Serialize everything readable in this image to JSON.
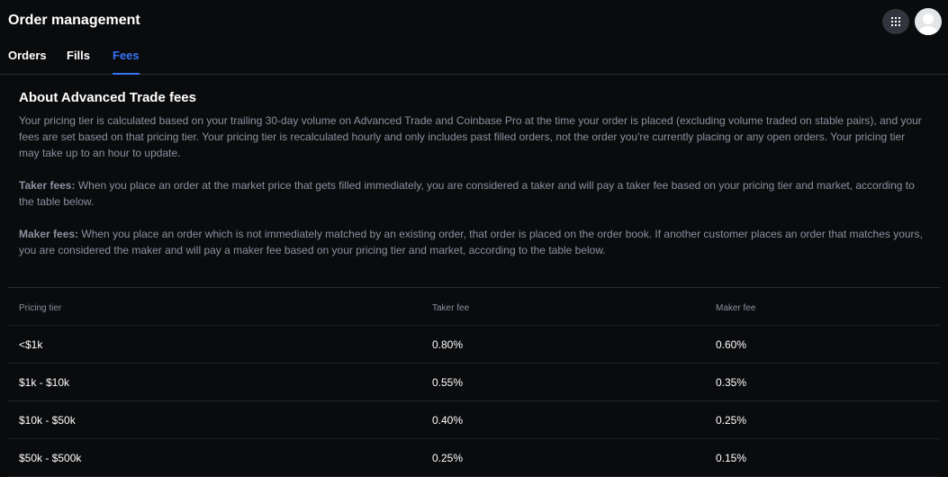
{
  "header": {
    "title": "Order management",
    "apps_icon": "grid-icon",
    "avatar_icon": "user-icon"
  },
  "tabs": [
    {
      "label": "Orders",
      "active": false
    },
    {
      "label": "Fills",
      "active": false
    },
    {
      "label": "Fees",
      "active": true
    }
  ],
  "about": {
    "heading": "About Advanced Trade fees",
    "intro": "Your pricing tier is calculated based on your trailing 30-day volume on Advanced Trade and Coinbase Pro at the time your order is placed (excluding volume traded on stable pairs), and your fees are set based on that pricing tier. Your pricing tier is recalculated hourly and only includes past filled orders, not the order you're currently placing or any open orders. Your pricing tier may take up to an hour to update.",
    "taker_label": "Taker fees:",
    "taker_text": " When you place an order at the market price that gets filled immediately, you are considered a taker and will pay a taker fee based on your pricing tier and market, according to the table below.",
    "maker_label": "Maker fees:",
    "maker_text": " When you place an order which is not immediately matched by an existing order, that order is placed on the order book. If another customer places an order that matches yours, you are considered the maker and will pay a maker fee based on your pricing tier and market, according to the table below."
  },
  "fee_table": {
    "columns": [
      "Pricing tier",
      "Taker fee",
      "Maker fee"
    ],
    "rows": [
      {
        "tier": "<$1k",
        "taker": "0.80%",
        "maker": "0.60%"
      },
      {
        "tier": "$1k - $10k",
        "taker": "0.55%",
        "maker": "0.35%"
      },
      {
        "tier": "$10k - $50k",
        "taker": "0.40%",
        "maker": "0.25%"
      },
      {
        "tier": "$50k - $500k",
        "taker": "0.25%",
        "maker": "0.15%"
      }
    ]
  },
  "colors": {
    "background": "#0a0b0d",
    "accent": "#3773f5",
    "muted_text": "#8a919e"
  }
}
